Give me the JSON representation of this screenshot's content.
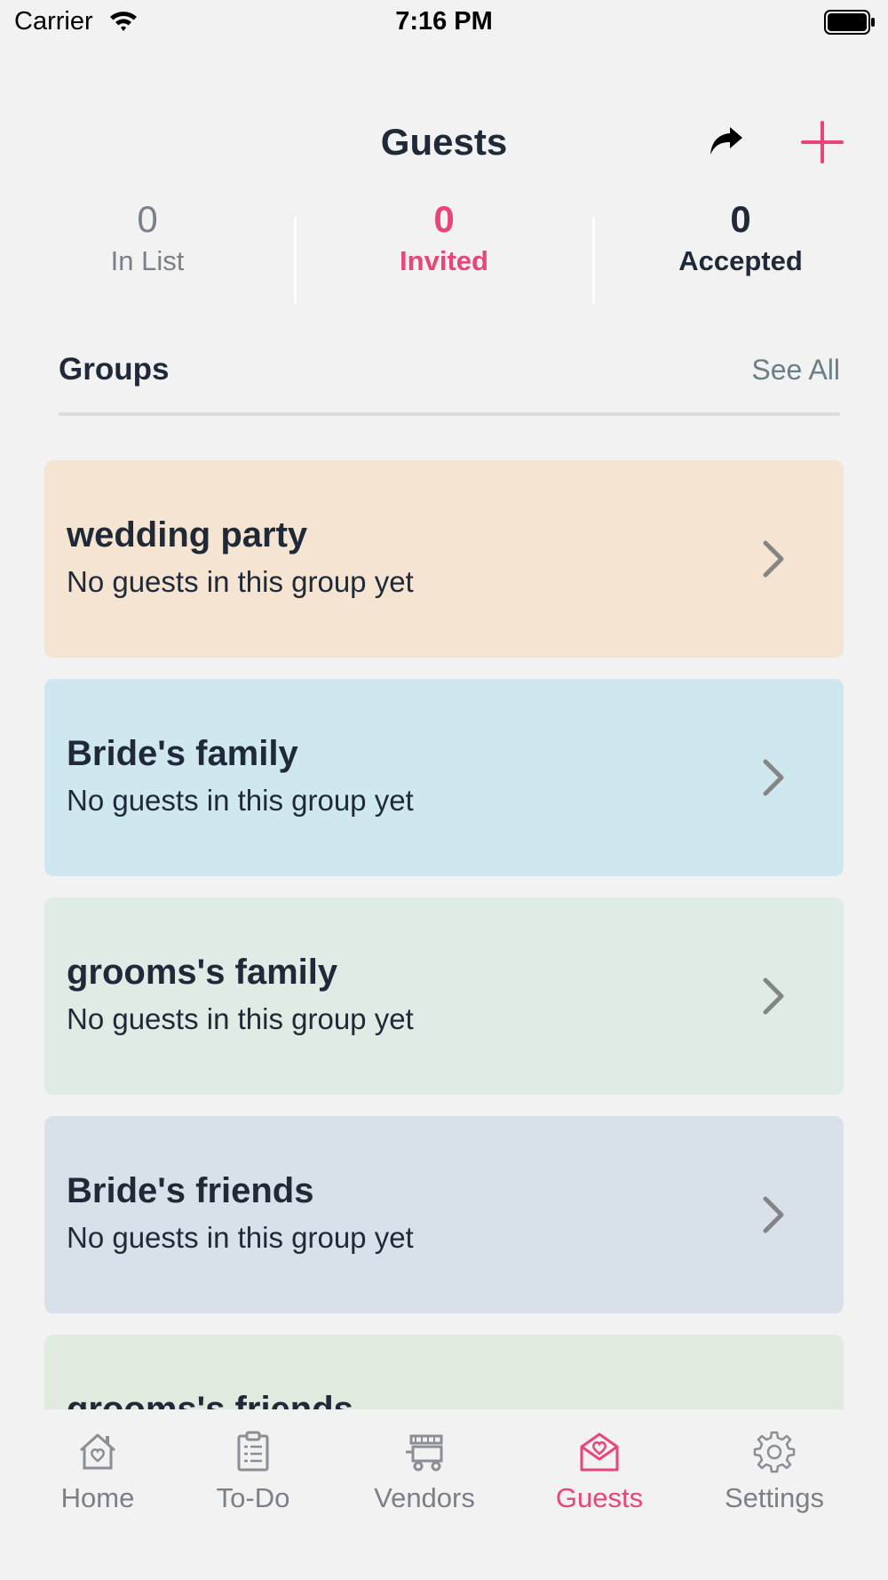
{
  "status_bar": {
    "carrier": "Carrier",
    "time": "7:16 PM"
  },
  "header": {
    "title": "Guests"
  },
  "stats": {
    "in_list": {
      "value": "0",
      "label": "In List"
    },
    "invited": {
      "value": "0",
      "label": "Invited"
    },
    "accepted": {
      "value": "0",
      "label": "Accepted"
    }
  },
  "groups": {
    "title": "Groups",
    "see_all": "See All",
    "items": [
      {
        "name": "wedding party",
        "subtitle": "No guests in this group yet",
        "color": "#f5e4d1"
      },
      {
        "name": "Bride's family",
        "subtitle": "No guests in this group yet",
        "color": "#cfe7ef"
      },
      {
        "name": "grooms's family",
        "subtitle": "No guests in this group yet",
        "color": "#dfece5"
      },
      {
        "name": "Bride's friends",
        "subtitle": "No guests in this group yet",
        "color": "#d8e1ea"
      },
      {
        "name": "grooms's friends",
        "subtitle": "",
        "color": "#e1eade"
      }
    ]
  },
  "tab_bar": {
    "items": [
      {
        "label": "Home",
        "icon": "home-heart-icon"
      },
      {
        "label": "To-Do",
        "icon": "clipboard-icon"
      },
      {
        "label": "Vendors",
        "icon": "vendor-cart-icon"
      },
      {
        "label": "Guests",
        "icon": "envelope-heart-icon",
        "active": true
      },
      {
        "label": "Settings",
        "icon": "gear-icon"
      }
    ],
    "active_color": "#e8457b",
    "inactive_color": "#7b8088"
  },
  "colors": {
    "accent": "#e8457b",
    "text": "#1f2937",
    "background": "#f2f2f2"
  }
}
